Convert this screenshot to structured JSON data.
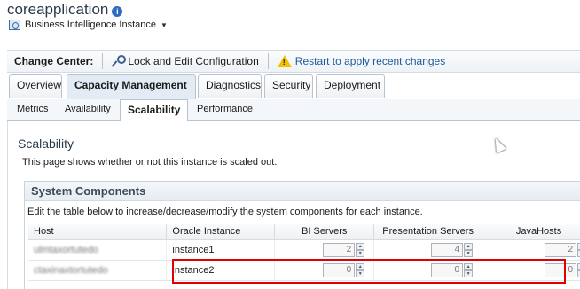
{
  "header": {
    "title": "coreapplication",
    "info_icon": "i",
    "target_label": "Business Intelligence Instance",
    "target_caret": "▼"
  },
  "change_center": {
    "label": "Change Center:",
    "lock_label": "Lock and Edit Configuration",
    "restart_label": "Restart to apply recent changes"
  },
  "tabs": [
    {
      "label": "Overview"
    },
    {
      "label": "Capacity Management"
    },
    {
      "label": "Diagnostics"
    },
    {
      "label": "Security"
    },
    {
      "label": "Deployment"
    }
  ],
  "subtabs": [
    {
      "label": "Metrics"
    },
    {
      "label": "Availability"
    },
    {
      "label": "Scalability"
    },
    {
      "label": "Performance"
    }
  ],
  "section": {
    "title": "Scalability",
    "description": "This page shows whether or not this instance is scaled out."
  },
  "system_components": {
    "title": "System Components",
    "description": "Edit the table below to increase/decrease/modify the system components for each instance.",
    "columns": [
      "Host",
      "Oracle Instance",
      "BI Servers",
      "Presentation Servers",
      "JavaHosts"
    ],
    "rows": [
      {
        "host": "ulmtaxortutedo",
        "instance": "instance1",
        "bi_servers": "2",
        "presentation_servers": "4",
        "javahosts": "2"
      },
      {
        "host": "ctaxinaxtortutedo",
        "instance": "instance2",
        "bi_servers": "0",
        "presentation_servers": "0",
        "javahosts": "0"
      }
    ]
  },
  "spinner": {
    "up": "▲",
    "down": "▼"
  },
  "colors": {
    "highlight": "#e00000",
    "accent": "#1a5a9c",
    "warning": "#f2c200"
  }
}
